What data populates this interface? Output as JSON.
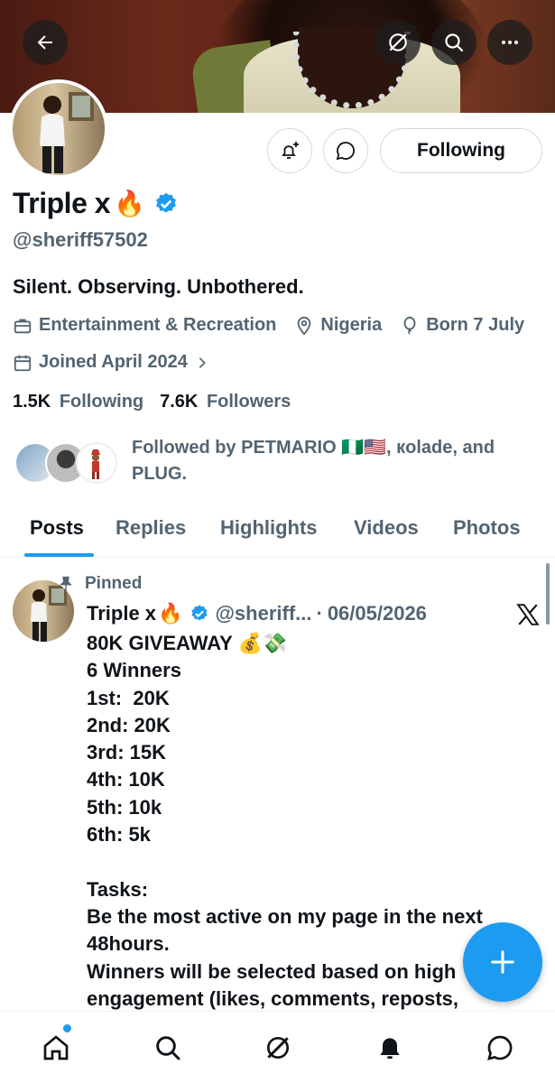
{
  "profile": {
    "name": "Triple x",
    "name_emoji": "🔥",
    "handle": "@sheriff57502",
    "bio": "Silent. Observing. Unbothered.",
    "category": "Entertainment & Recreation",
    "location": "Nigeria",
    "born": "Born 7 July",
    "joined": "Joined April 2024",
    "following_count": "1.5K",
    "following_label": "Following",
    "followers_count": "7.6K",
    "followers_label": "Followers",
    "followed_by": "Followed by PETMARIO 🇳🇬🇺🇸, кolade, and PLUG."
  },
  "actions": {
    "following_button": "Following"
  },
  "tabs": [
    {
      "label": "Posts",
      "active": true
    },
    {
      "label": "Replies"
    },
    {
      "label": "Highlights"
    },
    {
      "label": "Videos"
    },
    {
      "label": "Photos"
    }
  ],
  "post": {
    "pinned_label": "Pinned",
    "author": "Triple x",
    "author_emoji": "🔥",
    "handle_truncated": "@sheriff...",
    "separator": "·",
    "date": "06/05/2026",
    "lines": [
      "80K GIVEAWAY 💰💸",
      "6 Winners",
      "1st:  20K",
      "2nd: 20K",
      "3rd: 15K",
      "4th: 10K",
      "5th: 10k",
      "6th: 5k",
      "",
      "Tasks:",
      "Be the most active on my page in the next 48hours.",
      "Winners will be selected based on high",
      "engagement (likes, comments, reposts,"
    ]
  },
  "colors": {
    "accent": "#1d9bf0",
    "text_primary": "#0f1419",
    "text_secondary": "#536471",
    "border": "#cfd9de"
  },
  "icons": {
    "back": "arrow-left-icon",
    "grok": "grok-icon",
    "search": "search-icon",
    "more": "more-icon",
    "notify": "bell-plus-icon",
    "message": "chat-bubble-icon",
    "verified": "verified-badge-icon",
    "category": "briefcase-icon",
    "location": "location-pin-icon",
    "born": "balloon-icon",
    "joined": "calendar-icon",
    "pin": "pin-icon",
    "x_logo": "x-logo-icon",
    "compose": "plus-icon",
    "home": "home-icon",
    "notifications": "bell-icon",
    "messages": "message-icon"
  }
}
